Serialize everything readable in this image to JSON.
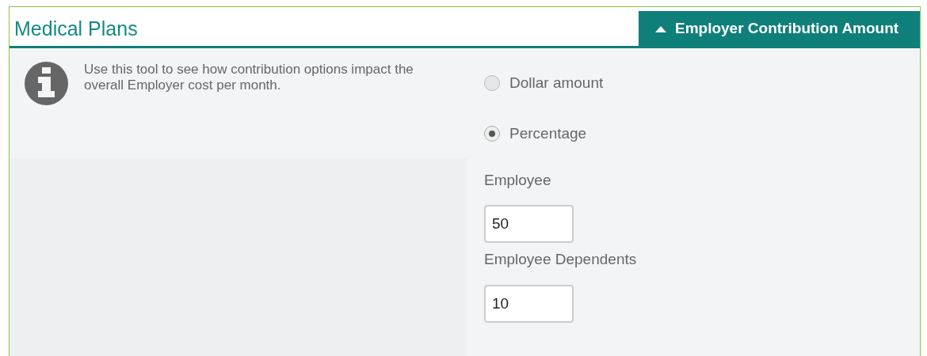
{
  "header": {
    "title": "Medical Plans",
    "tab": {
      "label": "Employer Contribution Amount",
      "expanded": true
    }
  },
  "info": {
    "text": "Use this tool to see how contribution options impact the overall Employer cost per month."
  },
  "contribution_type": [
    {
      "label": "Dollar amount",
      "selected": false
    },
    {
      "label": "Percentage",
      "selected": true
    }
  ],
  "fields": [
    {
      "label": "Employee",
      "value": "50"
    },
    {
      "label": "Employee Dependents",
      "value": "10"
    }
  ]
}
